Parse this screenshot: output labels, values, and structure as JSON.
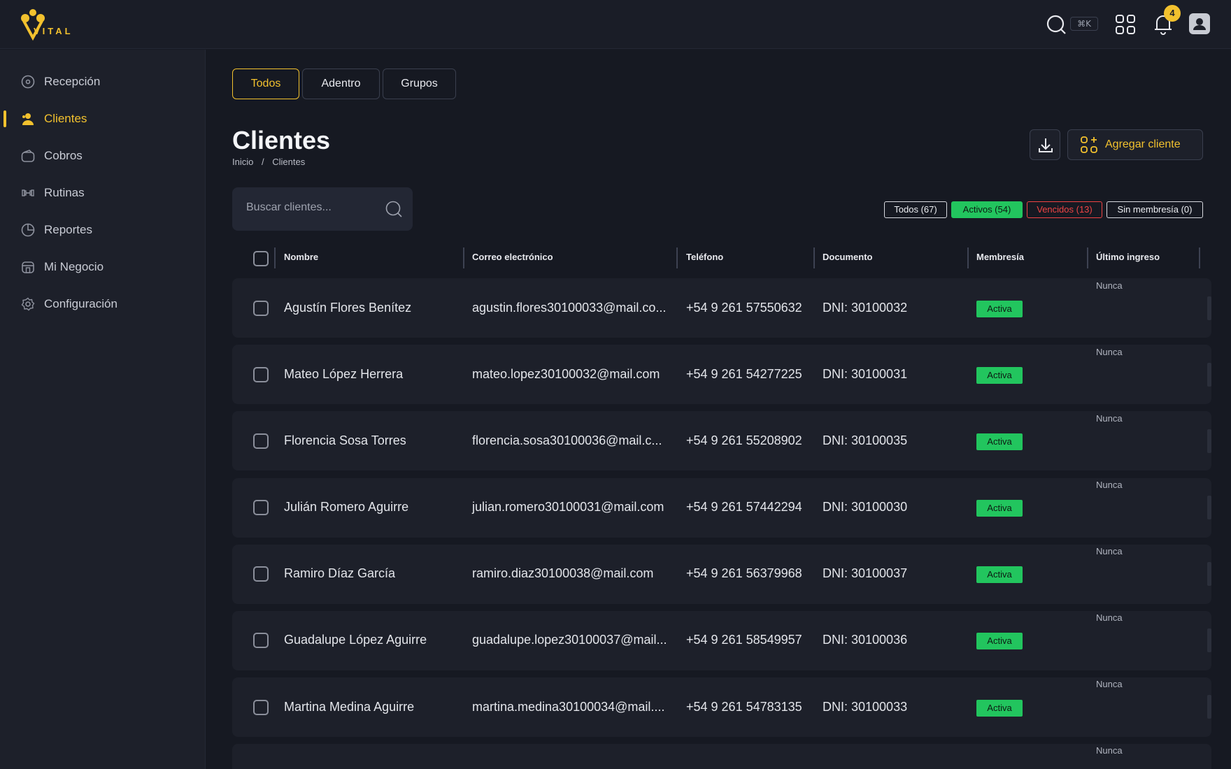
{
  "app": {
    "logo_text": "VITAL",
    "search_shortcut": "⌘K",
    "notifications_count": "4",
    "accent_color": "#f2c12e",
    "active_color": "#22c55e",
    "expired_color": "#ef4444"
  },
  "sidebar": {
    "items": [
      {
        "label": "Recepción",
        "icon": "reception-icon",
        "active": false
      },
      {
        "label": "Clientes",
        "icon": "clients-icon",
        "active": true
      },
      {
        "label": "Cobros",
        "icon": "wallet-icon",
        "active": false
      },
      {
        "label": "Rutinas",
        "icon": "dumbbell-icon",
        "active": false
      },
      {
        "label": "Reportes",
        "icon": "pie-chart-icon",
        "active": false
      },
      {
        "label": "Mi Negocio",
        "icon": "store-icon",
        "active": false
      },
      {
        "label": "Configuración",
        "icon": "gear-icon",
        "active": false
      }
    ]
  },
  "tabs": [
    "Todos",
    "Adentro",
    "Grupos"
  ],
  "page": {
    "title": "Clientes",
    "breadcrumb": [
      "Inicio",
      "/",
      "Clientes"
    ],
    "add_button": "Agregar cliente"
  },
  "search": {
    "placeholder": "Buscar clientes..."
  },
  "filters": [
    {
      "label": "Todos (67)",
      "style": "neutral"
    },
    {
      "label": "Activos (54)",
      "style": "active"
    },
    {
      "label": "Vencidos (13)",
      "style": "expired"
    },
    {
      "label": "Sin membresía (0)",
      "style": "neutral"
    }
  ],
  "table": {
    "headers": [
      "Nombre",
      "Correo electrónico",
      "Teléfono",
      "Documento",
      "Membresía",
      "Último ingreso"
    ],
    "rows": [
      {
        "name": "Agustín Flores Benítez",
        "email": "agustin.flores30100033@mail.co...",
        "phone": "+54 9 261 57550632",
        "doc": "DNI: 30100032",
        "membership": "Activa",
        "last": "Nunca"
      },
      {
        "name": "Mateo López Herrera",
        "email": "mateo.lopez30100032@mail.com",
        "phone": "+54 9 261 54277225",
        "doc": "DNI: 30100031",
        "membership": "Activa",
        "last": "Nunca"
      },
      {
        "name": "Florencia Sosa Torres",
        "email": "florencia.sosa30100036@mail.c...",
        "phone": "+54 9 261 55208902",
        "doc": "DNI: 30100035",
        "membership": "Activa",
        "last": "Nunca"
      },
      {
        "name": "Julián Romero Aguirre",
        "email": "julian.romero30100031@mail.com",
        "phone": "+54 9 261 57442294",
        "doc": "DNI: 30100030",
        "membership": "Activa",
        "last": "Nunca"
      },
      {
        "name": "Ramiro Díaz García",
        "email": "ramiro.diaz30100038@mail.com",
        "phone": "+54 9 261 56379968",
        "doc": "DNI: 30100037",
        "membership": "Activa",
        "last": "Nunca"
      },
      {
        "name": "Guadalupe López Aguirre",
        "email": "guadalupe.lopez30100037@mail...",
        "phone": "+54 9 261 58549957",
        "doc": "DNI: 30100036",
        "membership": "Activa",
        "last": "Nunca"
      },
      {
        "name": "Martina Medina Aguirre",
        "email": "martina.medina30100034@mail....",
        "phone": "+54 9 261 54783135",
        "doc": "DNI: 30100033",
        "membership": "Activa",
        "last": "Nunca"
      },
      {
        "name": "",
        "email": "",
        "phone": "",
        "doc": "",
        "membership": "",
        "last": "Nunca"
      }
    ]
  }
}
